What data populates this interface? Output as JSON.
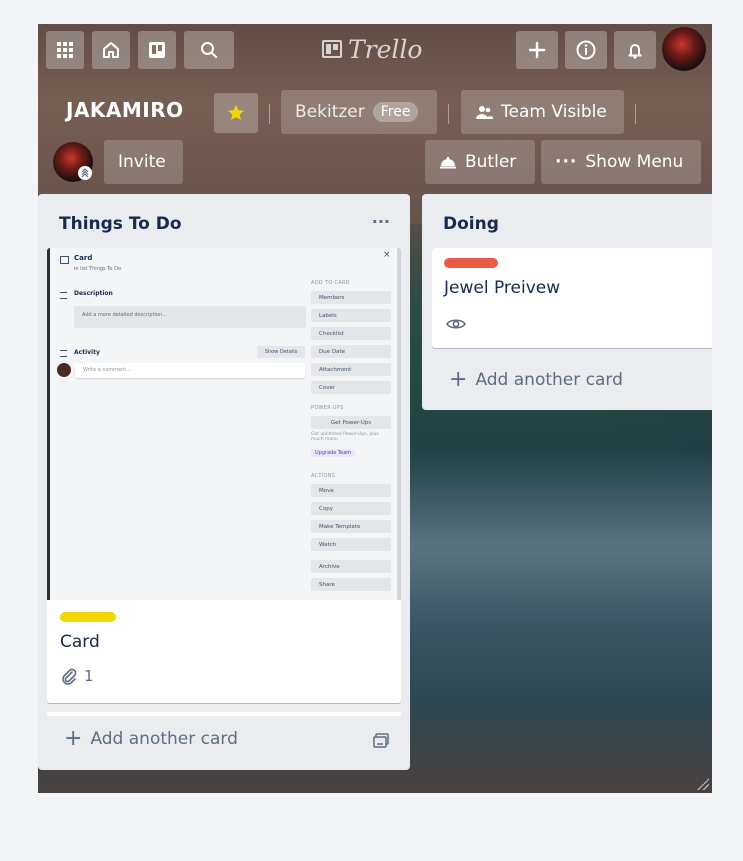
{
  "header": {
    "logo_text": "Trello",
    "icons": [
      "apps-grid-icon",
      "home-icon",
      "boards-icon",
      "search-icon",
      "plus-icon",
      "info-icon",
      "bell-icon"
    ]
  },
  "board": {
    "name": "JAKAMIRO",
    "team_name": "Bekitzer",
    "team_plan": "Free",
    "visibility_label": "Team Visible",
    "invite_label": "Invite",
    "butler_label": "Butler",
    "show_menu_label": "Show Menu",
    "star_color": "#f2d600"
  },
  "lists": [
    {
      "title": "Things To Do",
      "menu_label": "···",
      "cards": [
        {
          "title": "Card",
          "label_color": "#f2d600",
          "attachments": "1",
          "has_cover_preview": true
        }
      ],
      "add_label": "Add another card"
    },
    {
      "title": "Doing",
      "cards": [
        {
          "title": "Jewel Preivew",
          "label_color": "#eb5a46",
          "watching": true
        }
      ],
      "add_label": "Add another card"
    }
  ],
  "preview": {
    "card_title": "Card",
    "in_list": "in list Things To Do",
    "description_label": "Description",
    "description_placeholder": "Add a more detailed description...",
    "activity_label": "Activity",
    "show_details": "Show Details",
    "comment_placeholder": "Write a comment...",
    "add_to_card": "ADD TO CARD",
    "add_items": [
      "Members",
      "Labels",
      "Checklist",
      "Due Date",
      "Attachment",
      "Cover"
    ],
    "power_ups": "POWER-UPS",
    "get_power_ups": "Get Power-Ups",
    "power_ups_note": "Get unlimited Power-Ups, plus much more.",
    "upgrade_team": "Upgrade Team",
    "actions": "ACTIONS",
    "action_items": [
      "Move",
      "Copy",
      "Make Template",
      "Watch",
      "Archive",
      "Share"
    ]
  }
}
